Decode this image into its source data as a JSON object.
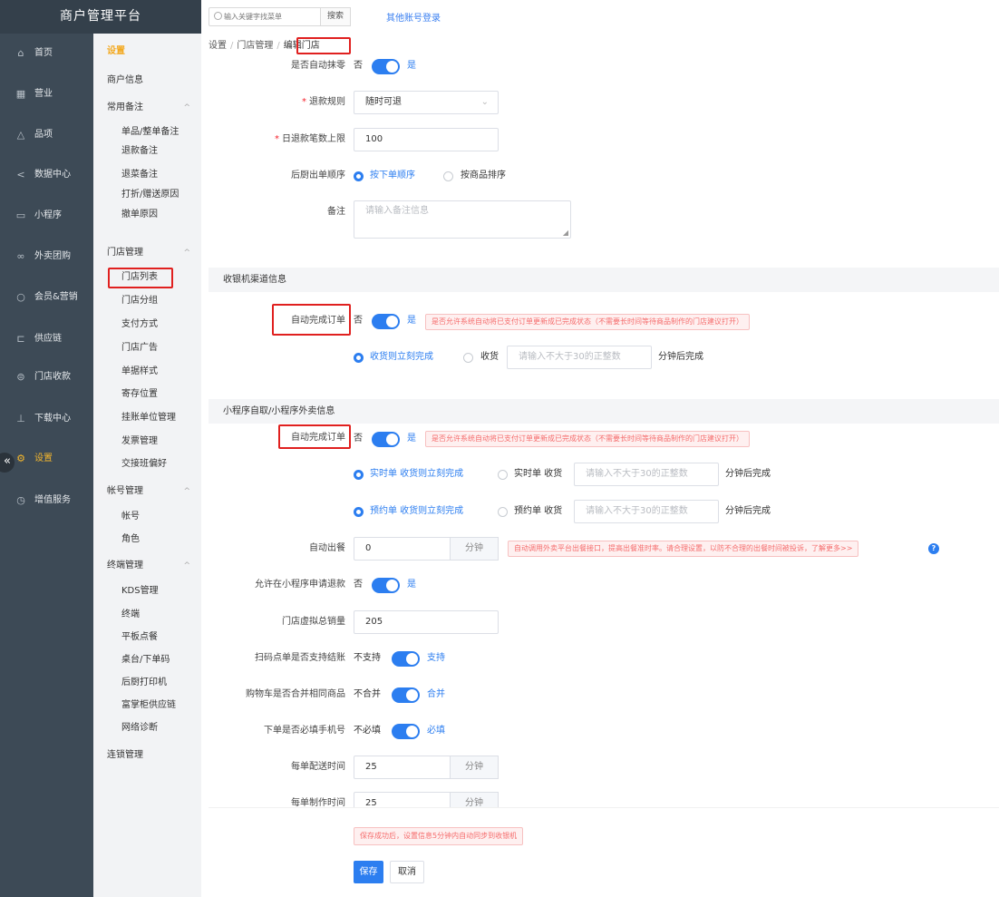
{
  "app": {
    "title": "商户管理平台"
  },
  "topbar": {
    "search_placeholder": "输入关键字找菜单",
    "search_button": "搜索",
    "other_login": "其他账号登录"
  },
  "leftnav": [
    {
      "label": "首页",
      "icon": "home-icon",
      "glyph": "⌂"
    },
    {
      "label": "营业",
      "icon": "calendar-icon",
      "glyph": "▦"
    },
    {
      "label": "品项",
      "icon": "food-icon",
      "glyph": "△"
    },
    {
      "label": "数据中心",
      "icon": "share-icon",
      "glyph": "<"
    },
    {
      "label": "小程序",
      "icon": "phone-icon",
      "glyph": "▭"
    },
    {
      "label": "外卖团购",
      "icon": "bike-icon",
      "glyph": "∞"
    },
    {
      "label": "会员&营销",
      "icon": "user-icon",
      "glyph": "○"
    },
    {
      "label": "供应链",
      "icon": "truck-icon",
      "glyph": "⊏"
    },
    {
      "label": "门店收款",
      "icon": "database-icon",
      "glyph": "⊜"
    },
    {
      "label": "下载中心",
      "icon": "download-icon",
      "glyph": "⊥"
    },
    {
      "label": "设置",
      "icon": "gear-icon",
      "glyph": "⚙"
    },
    {
      "label": "增值服务",
      "icon": "clock-icon",
      "glyph": "◷"
    }
  ],
  "subnav": {
    "head": "设置",
    "merchant_info": "商户信息",
    "groups": [
      {
        "label": "常用备注",
        "items": [
          "单品/整单备注",
          "退款备注",
          "退菜备注",
          "打折/赠送原因",
          "撤单原因"
        ]
      },
      {
        "label": "门店管理",
        "items": [
          "门店列表",
          "门店分组",
          "支付方式",
          "门店广告",
          "单据样式",
          "寄存位置",
          "挂账单位管理",
          "发票管理",
          "交接班偏好"
        ]
      },
      {
        "label": "帐号管理",
        "items": [
          "帐号",
          "角色"
        ]
      },
      {
        "label": "终端管理",
        "items": [
          "KDS管理",
          "终端",
          "平板点餐",
          "桌台/下单码",
          "后厨打印机",
          "富掌柜供应链",
          "网络诊断"
        ]
      }
    ],
    "chain": "连锁管理",
    "caret": "^"
  },
  "breadcrumb": [
    "设置",
    "门店管理",
    "编辑门店"
  ],
  "form": {
    "auto_zero": {
      "label": "是否自动抹零",
      "off": "否",
      "on": "是"
    },
    "refund_rule": {
      "label": "退款规则",
      "value": "随时可退"
    },
    "daily_refund_limit": {
      "label": "日退款笔数上限",
      "value": "100"
    },
    "kitchen_order": {
      "label": "后厨出单顺序",
      "option1": "按下单顺序",
      "option2": "按商品排序"
    },
    "remark": {
      "label": "备注",
      "placeholder": "请输入备注信息"
    },
    "cashier_section": "收银机渠道信息",
    "cashier_auto_complete": {
      "label": "自动完成订单",
      "off": "否",
      "on": "是",
      "tip": "是否允许系统自动将已支付订单更新成已完成状态（不需要长时间等待商品制作的门店建议打开）",
      "option1": "收货则立刻完成",
      "option2": "收货",
      "placeholder": "请输入不大于30的正整数",
      "suffix": "分钟后完成"
    },
    "miniapp_section": "小程序自取/小程序外卖信息",
    "miniapp_auto_complete": {
      "label": "自动完成订单",
      "off": "否",
      "on": "是",
      "tip": "是否允许系统自动将已支付订单更新成已完成状态（不需要长时间等待商品制作的门店建议打开）"
    },
    "realtime": {
      "option1": "实时单 收货则立刻完成",
      "option2": "实时单 收货",
      "placeholder": "请输入不大于30的正整数",
      "suffix": "分钟后完成"
    },
    "reservation": {
      "option1": "预约单 收货则立刻完成",
      "option2": "预约单 收货",
      "placeholder": "请输入不大于30的正整数",
      "suffix": "分钟后完成"
    },
    "auto_meal": {
      "label": "自动出餐",
      "value": "0",
      "unit": "分钟",
      "tip": "自动调用外卖平台出餐接口，提高出餐准时率。请合理设置，以防不合理的出餐时间被投诉，了解更多>>",
      "help": "?"
    },
    "allow_refund": {
      "label": "允许在小程序申请退款",
      "off": "否",
      "on": "是"
    },
    "virtual_sales": {
      "label": "门店虚拟总销量",
      "value": "205"
    },
    "scan_checkout": {
      "label": "扫码点单是否支持结账",
      "off": "不支持",
      "on": "支持"
    },
    "merge_cart": {
      "label": "购物车是否合并相同商品",
      "off": "不合并",
      "on": "合并"
    },
    "require_phone": {
      "label": "下单是否必填手机号",
      "off": "不必填",
      "on": "必填"
    },
    "delivery_time": {
      "label": "每单配送时间",
      "value": "25",
      "unit": "分钟"
    },
    "make_time": {
      "label": "每单制作时间",
      "value": "25",
      "unit": "分钟"
    }
  },
  "footer": {
    "notice": "保存成功后，设置信息5分钟内自动同步到收银机",
    "save": "保存",
    "cancel": "取消"
  },
  "colors": {
    "primary": "#2c7ef0",
    "active_nav": "#f3b62d",
    "highlight": "#e0201f"
  }
}
